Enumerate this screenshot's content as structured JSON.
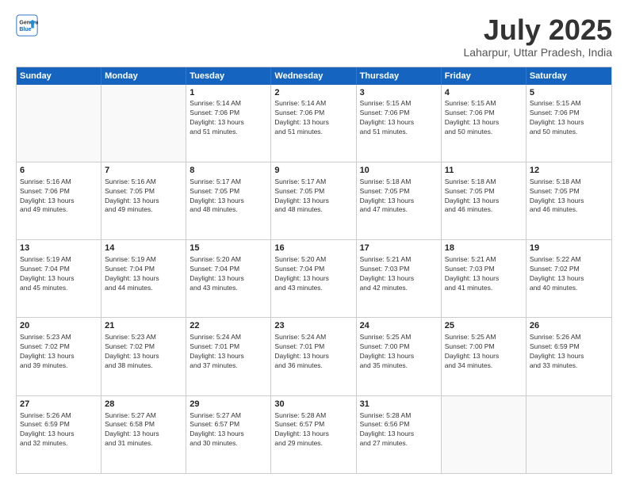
{
  "header": {
    "logo_general": "General",
    "logo_blue": "Blue",
    "month_title": "July 2025",
    "location": "Laharpur, Uttar Pradesh, India"
  },
  "weekdays": [
    "Sunday",
    "Monday",
    "Tuesday",
    "Wednesday",
    "Thursday",
    "Friday",
    "Saturday"
  ],
  "rows": [
    [
      {
        "day": "",
        "info": ""
      },
      {
        "day": "",
        "info": ""
      },
      {
        "day": "1",
        "info": "Sunrise: 5:14 AM\nSunset: 7:06 PM\nDaylight: 13 hours\nand 51 minutes."
      },
      {
        "day": "2",
        "info": "Sunrise: 5:14 AM\nSunset: 7:06 PM\nDaylight: 13 hours\nand 51 minutes."
      },
      {
        "day": "3",
        "info": "Sunrise: 5:15 AM\nSunset: 7:06 PM\nDaylight: 13 hours\nand 51 minutes."
      },
      {
        "day": "4",
        "info": "Sunrise: 5:15 AM\nSunset: 7:06 PM\nDaylight: 13 hours\nand 50 minutes."
      },
      {
        "day": "5",
        "info": "Sunrise: 5:15 AM\nSunset: 7:06 PM\nDaylight: 13 hours\nand 50 minutes."
      }
    ],
    [
      {
        "day": "6",
        "info": "Sunrise: 5:16 AM\nSunset: 7:06 PM\nDaylight: 13 hours\nand 49 minutes."
      },
      {
        "day": "7",
        "info": "Sunrise: 5:16 AM\nSunset: 7:05 PM\nDaylight: 13 hours\nand 49 minutes."
      },
      {
        "day": "8",
        "info": "Sunrise: 5:17 AM\nSunset: 7:05 PM\nDaylight: 13 hours\nand 48 minutes."
      },
      {
        "day": "9",
        "info": "Sunrise: 5:17 AM\nSunset: 7:05 PM\nDaylight: 13 hours\nand 48 minutes."
      },
      {
        "day": "10",
        "info": "Sunrise: 5:18 AM\nSunset: 7:05 PM\nDaylight: 13 hours\nand 47 minutes."
      },
      {
        "day": "11",
        "info": "Sunrise: 5:18 AM\nSunset: 7:05 PM\nDaylight: 13 hours\nand 46 minutes."
      },
      {
        "day": "12",
        "info": "Sunrise: 5:18 AM\nSunset: 7:05 PM\nDaylight: 13 hours\nand 46 minutes."
      }
    ],
    [
      {
        "day": "13",
        "info": "Sunrise: 5:19 AM\nSunset: 7:04 PM\nDaylight: 13 hours\nand 45 minutes."
      },
      {
        "day": "14",
        "info": "Sunrise: 5:19 AM\nSunset: 7:04 PM\nDaylight: 13 hours\nand 44 minutes."
      },
      {
        "day": "15",
        "info": "Sunrise: 5:20 AM\nSunset: 7:04 PM\nDaylight: 13 hours\nand 43 minutes."
      },
      {
        "day": "16",
        "info": "Sunrise: 5:20 AM\nSunset: 7:04 PM\nDaylight: 13 hours\nand 43 minutes."
      },
      {
        "day": "17",
        "info": "Sunrise: 5:21 AM\nSunset: 7:03 PM\nDaylight: 13 hours\nand 42 minutes."
      },
      {
        "day": "18",
        "info": "Sunrise: 5:21 AM\nSunset: 7:03 PM\nDaylight: 13 hours\nand 41 minutes."
      },
      {
        "day": "19",
        "info": "Sunrise: 5:22 AM\nSunset: 7:02 PM\nDaylight: 13 hours\nand 40 minutes."
      }
    ],
    [
      {
        "day": "20",
        "info": "Sunrise: 5:23 AM\nSunset: 7:02 PM\nDaylight: 13 hours\nand 39 minutes."
      },
      {
        "day": "21",
        "info": "Sunrise: 5:23 AM\nSunset: 7:02 PM\nDaylight: 13 hours\nand 38 minutes."
      },
      {
        "day": "22",
        "info": "Sunrise: 5:24 AM\nSunset: 7:01 PM\nDaylight: 13 hours\nand 37 minutes."
      },
      {
        "day": "23",
        "info": "Sunrise: 5:24 AM\nSunset: 7:01 PM\nDaylight: 13 hours\nand 36 minutes."
      },
      {
        "day": "24",
        "info": "Sunrise: 5:25 AM\nSunset: 7:00 PM\nDaylight: 13 hours\nand 35 minutes."
      },
      {
        "day": "25",
        "info": "Sunrise: 5:25 AM\nSunset: 7:00 PM\nDaylight: 13 hours\nand 34 minutes."
      },
      {
        "day": "26",
        "info": "Sunrise: 5:26 AM\nSunset: 6:59 PM\nDaylight: 13 hours\nand 33 minutes."
      }
    ],
    [
      {
        "day": "27",
        "info": "Sunrise: 5:26 AM\nSunset: 6:59 PM\nDaylight: 13 hours\nand 32 minutes."
      },
      {
        "day": "28",
        "info": "Sunrise: 5:27 AM\nSunset: 6:58 PM\nDaylight: 13 hours\nand 31 minutes."
      },
      {
        "day": "29",
        "info": "Sunrise: 5:27 AM\nSunset: 6:57 PM\nDaylight: 13 hours\nand 30 minutes."
      },
      {
        "day": "30",
        "info": "Sunrise: 5:28 AM\nSunset: 6:57 PM\nDaylight: 13 hours\nand 29 minutes."
      },
      {
        "day": "31",
        "info": "Sunrise: 5:28 AM\nSunset: 6:56 PM\nDaylight: 13 hours\nand 27 minutes."
      },
      {
        "day": "",
        "info": ""
      },
      {
        "day": "",
        "info": ""
      }
    ]
  ]
}
